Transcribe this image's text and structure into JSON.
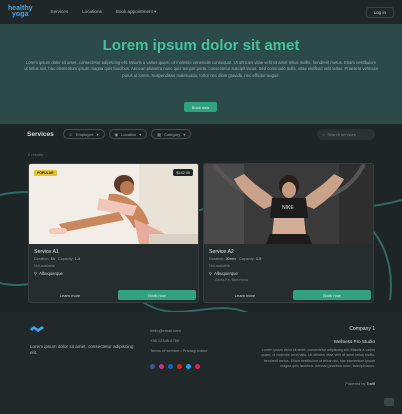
{
  "header": {
    "logo_line1": "healthy",
    "logo_line2": "yoga",
    "nav": [
      "Services",
      "Locations",
      "Book appointment ▾"
    ],
    "signin_label": "Log in"
  },
  "hero": {
    "title": "Lorem ipsum dolor sit amet",
    "body": "Lorem ipsum dolor sit amet, consectetur adipiscing elit. Mauris a varius quam, ut molestie venenatis consequat. Ut ultricies vitae velit sit amet tellus mollis, hendrerit metus. Etiam vestibulum ut tellus nisl, hac elementum ipsum magna quis faucibus. Aenean pharetra nunc quis tempor porta, consectetur suscipit lacus. Sed commodo nulla, vitae eleifend velit tellus. Praesent vehicula purus ut lorem. Suspendisse malesuada, tortor nec diam gravida, nec efficitur augue.",
    "cta_label": "Book now"
  },
  "toolbar": {
    "title": "Services",
    "filters": [
      "Employee",
      "Location",
      "Category"
    ],
    "search_placeholder": "Search services"
  },
  "results": {
    "count_label": "2 results"
  },
  "cards": [
    {
      "tag": "POPULAR",
      "price": "$142.00",
      "name": "Service A1",
      "duration_label": "Duration:",
      "duration_value": "1h",
      "capacity_label": "Capacity:",
      "capacity_value": "1-4",
      "subtitle": "Not available",
      "location": "Albuquerque",
      "location_sub": "",
      "secondary_label": "Learn more",
      "primary_label": "Book now"
    },
    {
      "tag": "",
      "price": "",
      "name": "Service A2",
      "duration_label": "Duration:",
      "duration_value": "30min",
      "capacity_label": "Capacity:",
      "capacity_value": "1-5",
      "subtitle": "Not available",
      "location": "Albuquerque",
      "location_sub": "Santa Fe, Barcelona",
      "secondary_label": "Learn more",
      "primary_label": "Book now"
    }
  ],
  "footer": {
    "text": "Lorem ipsum dolor sit amet, consectetur adipiscing elit.",
    "links": [
      "hello@email.com",
      "+38 12345 6789",
      "Terms of service • Privacy notice"
    ],
    "company_name": "Company 1",
    "company_title": "Wellness Pro Studio",
    "company_desc": "Lorem ipsum dolor sit amet, consectetur adipiscing elit. Mauris a varius quam, ut molestie venenatis. Ut ultricies vitae velit sit amet tellus mollis, hendrerit metus. Etiam vestibulum ut tellus nisl, hac elementum ipsum magna quis faucibus. Aenean pharetra nunc, suscipit lacus.",
    "powered_label": "Powered by",
    "powered_value": "Trafft"
  },
  "colors": {
    "accent": "#33a07f",
    "title": "#45c19c",
    "logo": "#3fa9f5",
    "background": "#1e2526",
    "hero": "#2c4a48"
  },
  "icons": [
    "chevron-down-icon",
    "user-icon",
    "location-icon",
    "category-icon",
    "search-icon",
    "pin-icon",
    "facebook-icon",
    "instagram-icon",
    "linkedin-icon",
    "youtube-icon",
    "twitter-icon",
    "tiktok-icon"
  ]
}
